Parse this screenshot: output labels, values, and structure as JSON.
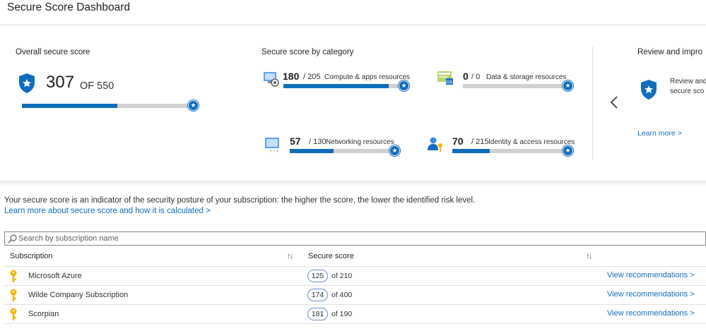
{
  "header": {
    "title": "Secure Score Dashboard"
  },
  "overall": {
    "title": "Overall secure score",
    "score": "307",
    "of_label": "OF 550",
    "fraction": 0.558
  },
  "categories": {
    "title": "Secure score by category",
    "items": [
      {
        "score": "180",
        "max": "/ 205",
        "name": "Compute & apps resources",
        "fraction": 0.878,
        "icon": "compute-icon"
      },
      {
        "score": "0",
        "max": "/ 0",
        "name": "Data & storage resources",
        "fraction": 0.0,
        "icon": "sql-storage-icon"
      },
      {
        "score": "57",
        "max": "/ 130",
        "name": "Networking resources",
        "fraction": 0.438,
        "icon": "network-icon"
      },
      {
        "score": "70",
        "max": "/ 215",
        "name": "Identity & access resources",
        "fraction": 0.326,
        "icon": "identity-key-icon"
      }
    ]
  },
  "review": {
    "title": "Review and impro",
    "line1": "Review and",
    "line2": "secure sco",
    "learn_more": "Learn more >"
  },
  "intro": {
    "text": "Your secure score is an indicator of the security posture of your subscription: the higher the score, the lower the identified risk level.",
    "link": "Learn more about secure score and how it is calculated >"
  },
  "search": {
    "placeholder": "Search by subscription name",
    "value": ""
  },
  "table": {
    "columns": [
      "Subscription",
      "Secure score"
    ],
    "rows": [
      {
        "name": "Microsoft Azure",
        "score": "125",
        "of": "of 210",
        "action": "View recommendations >"
      },
      {
        "name": "Wilde Company Subscription",
        "score": "174",
        "of": "of 400",
        "action": "View recommendations >"
      },
      {
        "name": "Scorpian",
        "score": "181",
        "of": "of 190",
        "action": "View recommendations >"
      }
    ]
  },
  "colors": {
    "accent": "#0f6cbd",
    "track": "#d2d0ce",
    "key": "#f2b705"
  }
}
